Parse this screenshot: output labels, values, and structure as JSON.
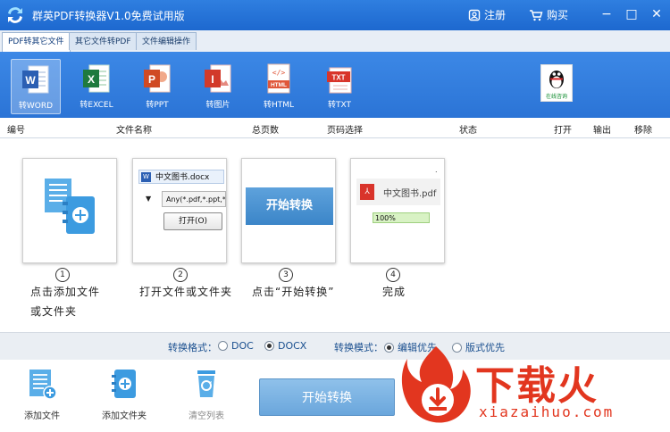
{
  "titlebar": {
    "title": "群英PDF转换器V1.0免费试用版",
    "register": "注册",
    "buy": "购买",
    "minimize": "−",
    "maximize": "□",
    "close": "✕"
  },
  "tabs": [
    {
      "label": "PDF转其它文件",
      "active": true
    },
    {
      "label": "其它文件转PDF",
      "active": false
    },
    {
      "label": "文件编辑操作",
      "active": false
    }
  ],
  "ribbon": {
    "tools": [
      {
        "label": "转WORD",
        "icon": "word-icon",
        "badge": "W",
        "color": "#2b5fb3",
        "selected": true
      },
      {
        "label": "转EXCEL",
        "icon": "excel-icon",
        "badge": "X",
        "color": "#1f7a3e",
        "selected": false
      },
      {
        "label": "转PPT",
        "icon": "ppt-icon",
        "badge": "P",
        "color": "#d04a23",
        "selected": false
      },
      {
        "label": "转图片",
        "icon": "image-icon",
        "badge": "I",
        "color": "#d23a2a",
        "selected": false
      },
      {
        "label": "转HTML",
        "icon": "html-icon",
        "badge": "HTML",
        "color": "#e0573a",
        "selected": false
      },
      {
        "label": "转TXT",
        "icon": "txt-icon",
        "badge": "TXT",
        "color": "#d8352a",
        "selected": false
      }
    ],
    "qq_label": "在线咨询"
  },
  "columns": [
    "编号",
    "文件名称",
    "总页数",
    "页码选择",
    "状态",
    "打开",
    "输出",
    "移除"
  ],
  "guide": {
    "steps": [
      {
        "num": "1",
        "caption_line1": "点击添加文件",
        "caption_line2": "或文件夹"
      },
      {
        "num": "2",
        "caption_line1": "打开文件或文件夹",
        "caption_line2": ""
      },
      {
        "num": "3",
        "caption_line1": "点击“开始转换”",
        "caption_line2": ""
      },
      {
        "num": "4",
        "caption_line1": "完成",
        "caption_line2": ""
      }
    ],
    "card2": {
      "filename": "中文图书.docx",
      "filter": "Any(*.pdf,*.ppt,*",
      "open_button": "打开(O)"
    },
    "card3": {
      "button": "开始转换"
    },
    "card4": {
      "filename": "中文图书.pdf",
      "progress": "100%",
      "progress_value": 100
    }
  },
  "options": {
    "format_label": "转换格式：",
    "format_options": [
      {
        "label": "DOC",
        "checked": false
      },
      {
        "label": "DOCX",
        "checked": true
      }
    ],
    "mode_label": "转换模式：",
    "mode_options": [
      {
        "label": "编辑优先",
        "checked": true
      },
      {
        "label": "版式优先",
        "checked": false
      }
    ]
  },
  "bottom": {
    "add_file": "添加文件",
    "add_folder": "添加文件夹",
    "clear_list": "清空列表",
    "start": "开始转换"
  },
  "watermark": {
    "brand": "下载火",
    "domain": "xiazaihuo.com"
  },
  "colors": {
    "accent": "#2b74d6",
    "watermark": "#e2361f",
    "start_button": "#7ab1e2"
  }
}
